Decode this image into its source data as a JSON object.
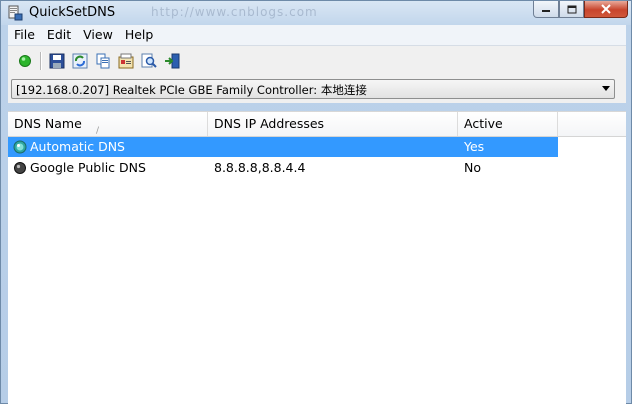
{
  "window": {
    "title": "QuickSetDNS",
    "address_blur": "http://www.cnblogs.com"
  },
  "menu": {
    "items": [
      "File",
      "Edit",
      "View",
      "Help"
    ]
  },
  "toolbar": {
    "icons": [
      "green-dot-icon",
      "save-icon",
      "refresh-icon",
      "copy-icon",
      "properties-icon",
      "find-icon",
      "exit-icon"
    ]
  },
  "adapter_combo": {
    "selected": "[192.168.0.207]  Realtek PCIe GBE Family Controller: 本地连接"
  },
  "list": {
    "columns": {
      "name": "DNS Name",
      "ip": "DNS IP Addresses",
      "active": "Active"
    },
    "sort_indicator": "/",
    "rows": [
      {
        "name": "Automatic DNS",
        "ip": "",
        "active": "Yes",
        "selected": true
      },
      {
        "name": "Google Public DNS",
        "ip": "8.8.8.8,8.8.4.4",
        "active": "No",
        "selected": false
      }
    ]
  },
  "colors": {
    "selection": "#3399ff",
    "accent_green": "#2db52d"
  }
}
